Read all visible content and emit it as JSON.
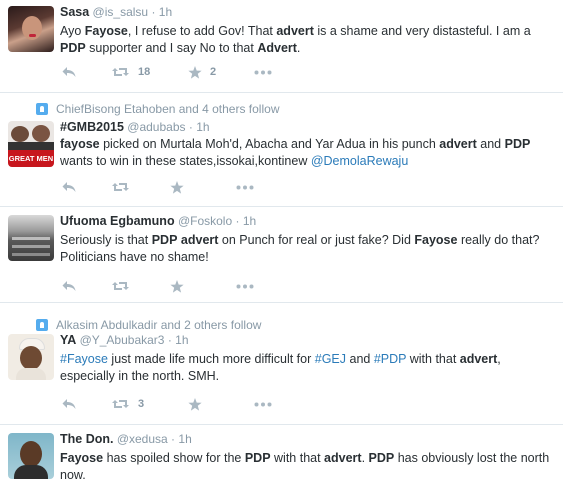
{
  "tweets": [
    {
      "name": "Sasa",
      "handle": "@is_salsu",
      "time": "1h",
      "context": "",
      "segments": [
        {
          "t": "Ayo ",
          "s": ""
        },
        {
          "t": "Fayose",
          "s": "b"
        },
        {
          "t": ", I refuse to add Gov! That ",
          "s": ""
        },
        {
          "t": "advert",
          "s": "b"
        },
        {
          "t": " is a shame and very distasteful. I am a ",
          "s": ""
        },
        {
          "t": "PDP",
          "s": "b"
        },
        {
          "t": " supporter and I say No to that ",
          "s": ""
        },
        {
          "t": "Advert",
          "s": "b"
        },
        {
          "t": ".",
          "s": ""
        }
      ],
      "retweets": "18",
      "favorites": "2"
    },
    {
      "name": "#GMB2015",
      "handle": "@adubabs",
      "time": "1h",
      "context": "ChiefBisong Etahoben and 4 others follow",
      "avatar_text": "GREAT MEN",
      "segments": [
        {
          "t": "fayose",
          "s": "b"
        },
        {
          "t": " picked on Murtala Moh'd, Abacha and Yar Adua in his punch ",
          "s": ""
        },
        {
          "t": "advert",
          "s": "b"
        },
        {
          "t": " and ",
          "s": ""
        },
        {
          "t": "PDP",
          "s": "b"
        },
        {
          "t": " wants to win in these states,issokai,kontinew ",
          "s": ""
        },
        {
          "t": "@DemolaRewaju",
          "s": "link"
        }
      ],
      "retweets": "",
      "favorites": ""
    },
    {
      "name": "Ufuoma Egbamuno",
      "handle": "@Foskolo",
      "time": "1h",
      "context": "",
      "segments": [
        {
          "t": "Seriously is that ",
          "s": ""
        },
        {
          "t": "PDP",
          "s": "b"
        },
        {
          "t": " ",
          "s": ""
        },
        {
          "t": "advert",
          "s": "b"
        },
        {
          "t": " on Punch for real or just fake? Did ",
          "s": ""
        },
        {
          "t": "Fayose",
          "s": "b"
        },
        {
          "t": " really do that? Politicians have no shame!",
          "s": ""
        }
      ],
      "retweets": "",
      "favorites": ""
    },
    {
      "name": "YA",
      "handle": "@Y_Abubakar3",
      "time": "1h",
      "context": "Alkasim Abdulkadir and 2 others follow",
      "segments": [
        {
          "t": "#Fayose",
          "s": "link"
        },
        {
          "t": " just made life much more difficult for ",
          "s": ""
        },
        {
          "t": "#GEJ",
          "s": "link"
        },
        {
          "t": " and ",
          "s": ""
        },
        {
          "t": "#PDP",
          "s": "link"
        },
        {
          "t": " with that ",
          "s": ""
        },
        {
          "t": "advert",
          "s": "b"
        },
        {
          "t": ", especially in the north. SMH.",
          "s": ""
        }
      ],
      "retweets": "3",
      "favorites": ""
    },
    {
      "name": "The Don.",
      "handle": "@xedusa",
      "time": "1h",
      "context": "",
      "segments": [
        {
          "t": "Fayose",
          "s": "b"
        },
        {
          "t": " has spoiled show for the ",
          "s": ""
        },
        {
          "t": "PDP",
          "s": "b"
        },
        {
          "t": " with that ",
          "s": ""
        },
        {
          "t": "advert",
          "s": "b"
        },
        {
          "t": ". ",
          "s": ""
        },
        {
          "t": "PDP",
          "s": "b"
        },
        {
          "t": " has obviously lost the north now.",
          "s": ""
        }
      ],
      "retweets": "",
      "favorites": ""
    }
  ],
  "separator": "·",
  "colors": {
    "link": "#2b7bb9",
    "muted": "#8899a6",
    "icon": "#aab8c2",
    "context_icon": "#55acee"
  },
  "icons": [
    "reply-icon",
    "retweet-icon",
    "favorite-icon",
    "more-icon",
    "follow-context-icon"
  ]
}
